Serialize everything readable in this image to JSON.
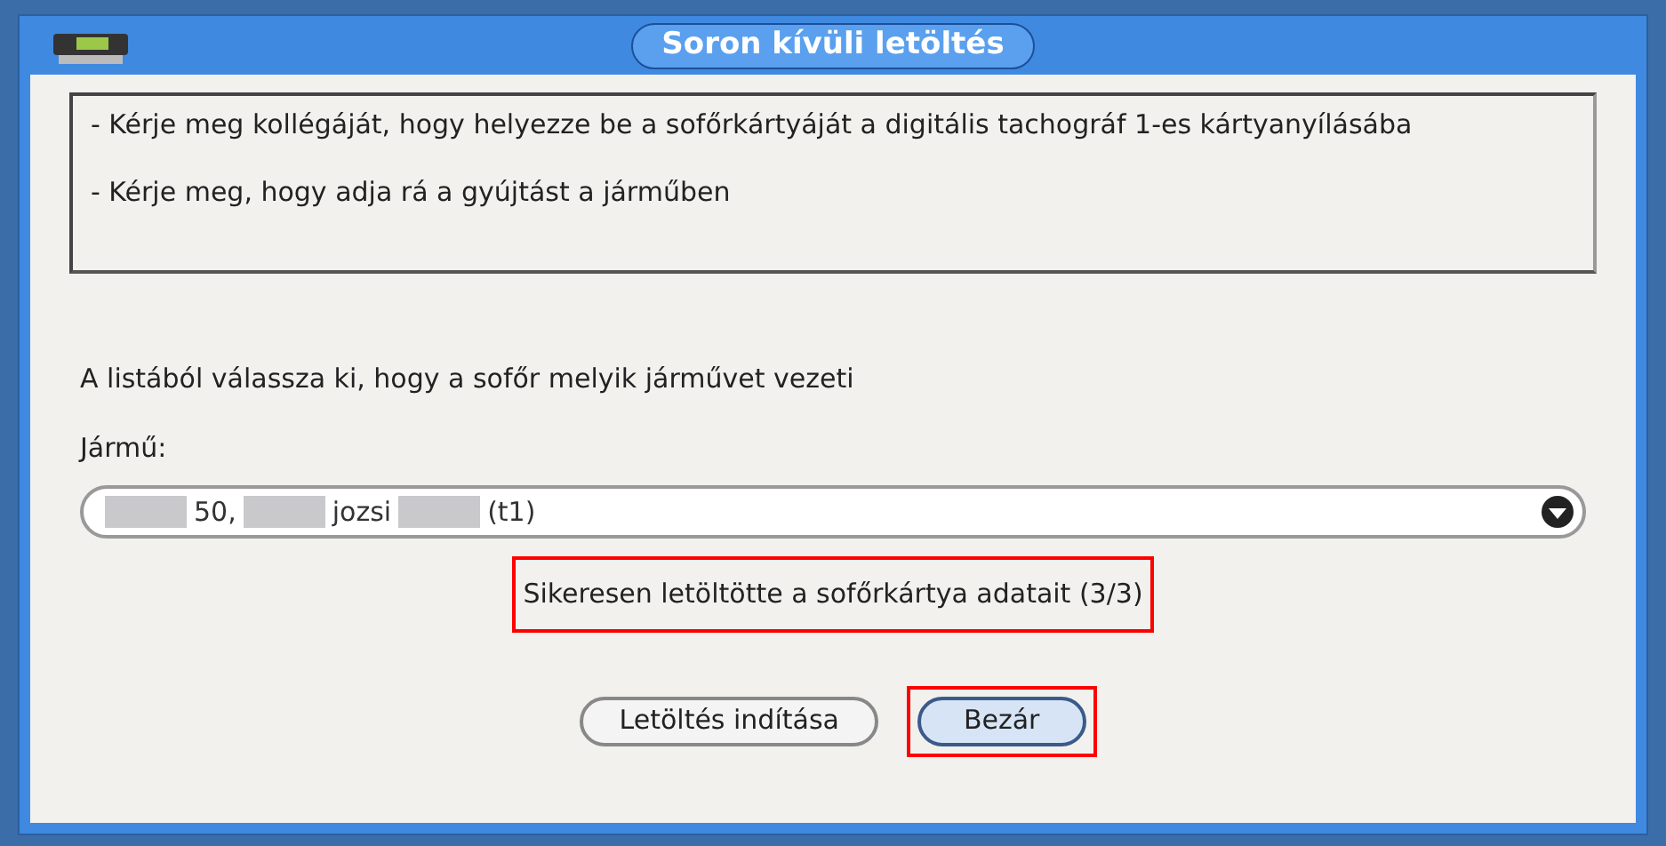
{
  "window": {
    "title": "Soron kívüli letöltés"
  },
  "instructions": [
    "- Kérje meg kollégáját, hogy helyezze be a sofőrkártyáját a digitális tachográf 1-es kártyanyílásába",
    "- Kérje meg, hogy adja rá a gyújtást a járműben"
  ],
  "prompt": "A listából válassza ki, hogy a sofőr melyik járművet vezeti",
  "vehicle_field": {
    "label": "Jármű:",
    "value_parts": [
      {
        "kind": "redacted"
      },
      {
        "kind": "text",
        "text": "50,"
      },
      {
        "kind": "redacted"
      },
      {
        "kind": "text",
        "text": "jozsi"
      },
      {
        "kind": "redacted"
      },
      {
        "kind": "text",
        "text": "(t1)"
      }
    ]
  },
  "status_message": {
    "text": "Sikeresen letöltötte a sofőrkártya adatait (3/3)",
    "highlighted": true
  },
  "buttons": [
    {
      "label": "Letöltés indítása",
      "focused": false,
      "highlighted": false
    },
    {
      "label": "Bezár",
      "focused": true,
      "highlighted": true
    }
  ]
}
